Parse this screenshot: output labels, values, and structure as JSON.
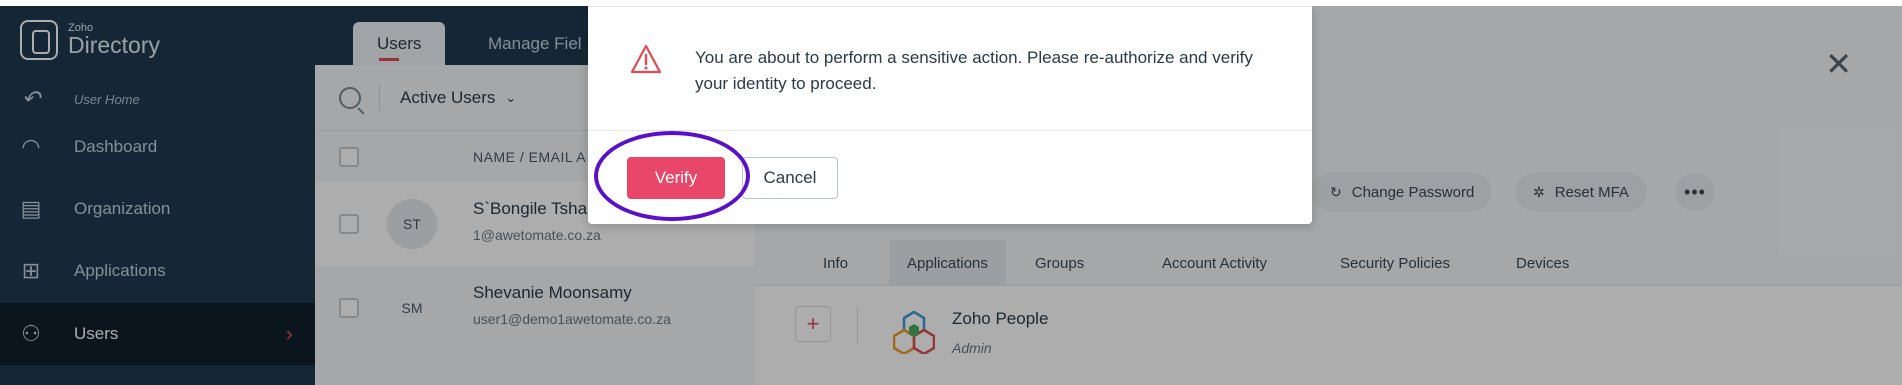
{
  "app": {
    "logo_small": "Zoho",
    "logo_big": "Directory"
  },
  "sidebar": {
    "items": [
      {
        "label": "User Home",
        "icon": "back-arrow-icon"
      },
      {
        "label": "Dashboard",
        "icon": "gauge-icon"
      },
      {
        "label": "Organization",
        "icon": "building-icon"
      },
      {
        "label": "Applications",
        "icon": "grid-apps-icon"
      },
      {
        "label": "Users",
        "icon": "user-icon",
        "active": true
      }
    ]
  },
  "tabs": [
    {
      "label": "Users",
      "active": true
    },
    {
      "label": "Manage Fiel"
    }
  ],
  "list": {
    "filter": "Active Users",
    "column_header": "NAME / EMAIL A",
    "rows": [
      {
        "initials": "ST",
        "name": "S`Bongile Tsha",
        "email": "1@awetomate.co.za"
      },
      {
        "initials": "SM",
        "name": "Shevanie Moonsamy",
        "email": "user1@demo1awetomate.co.za"
      }
    ]
  },
  "detail": {
    "actions": [
      "Change Password",
      "Reset MFA"
    ],
    "more": "•••",
    "tabs": [
      "Info",
      "Applications",
      "Groups",
      "Account Activity",
      "Security Policies",
      "Devices"
    ],
    "active_tab": "Applications",
    "app": {
      "name": "Zoho People",
      "role": "Admin"
    }
  },
  "modal": {
    "message": "You are about to perform a sensitive action. Please re-authorize and verify your identity to proceed.",
    "verify_label": "Verify",
    "cancel_label": "Cancel"
  },
  "colors": {
    "sidebar": "#1f3a50",
    "accent": "#e8476a",
    "highlight_ring": "#5a0fc8",
    "warning": "#e04b55"
  }
}
